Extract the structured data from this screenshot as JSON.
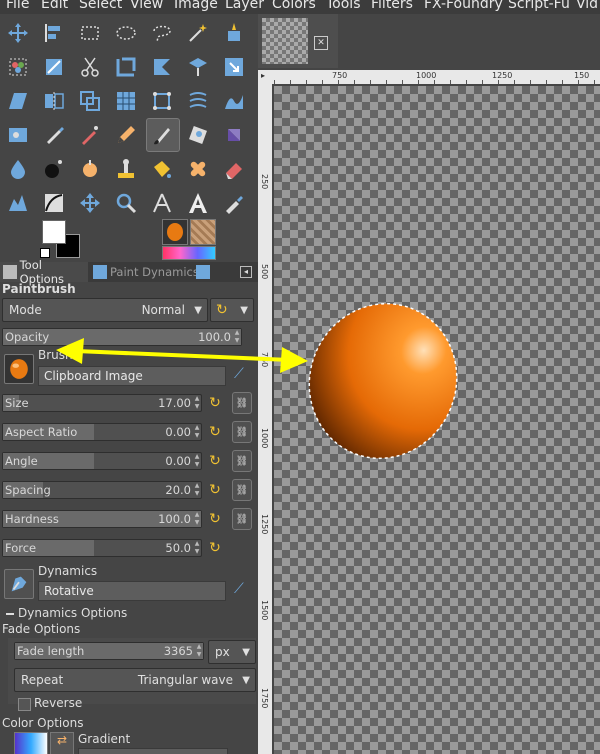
{
  "menubar": {
    "items": [
      "File",
      "Edit",
      "Select",
      "View",
      "Image",
      "Layer",
      "Colors",
      "Tools",
      "Filters",
      "FX-Foundry",
      "Script-Fu",
      "Vid"
    ]
  },
  "toolbox": {
    "tools": [
      [
        "move-tool-icon",
        "align-tool-icon",
        "rect-select-icon",
        "ellipse-select-icon",
        "free-select-icon",
        "fuzzy-select-icon",
        "scissors-select-icon"
      ],
      [
        "color-select-icon",
        "crop-icon",
        "cut-icon",
        "foreground-select-icon",
        "paths-icon",
        "perspective-icon",
        "scale-icon"
      ],
      [
        "shear-icon",
        "flip-icon",
        "layer-group-icon",
        "grid-icon",
        "cage-icon",
        "warp-icon",
        "wave-icon"
      ],
      [
        "heal-icon",
        "ink-icon",
        "airbrush-icon",
        "pencil-icon",
        "paintbrush-icon",
        "eraser-icon",
        "smudge-icon"
      ],
      [
        "drop-icon",
        "ball-icon",
        "clone-icon",
        "stamp-icon",
        "bucket-icon",
        "bandage-icon",
        "eraser-pink-icon"
      ],
      [
        "levels-icon",
        "curves-icon",
        "move-cross-icon",
        "zoom-icon",
        "measure-icon",
        "text-icon",
        "color-picker-icon"
      ]
    ]
  },
  "tabs": {
    "tool_options": "Tool Options",
    "paint_dynamics": "Paint Dynamics"
  },
  "options": {
    "title": "Paintbrush",
    "mode_label": "Mode",
    "mode_value": "Normal",
    "opacity": {
      "label": "Opacity",
      "value": "100.0",
      "fraction": 1.0
    },
    "brush_label": "Brush",
    "brush_value": "Clipboard Image",
    "size": {
      "label": "Size",
      "value": "17.00",
      "fraction": 0.08
    },
    "aspect_ratio": {
      "label": "Aspect Ratio",
      "value": "0.00",
      "fraction": 0.46
    },
    "angle": {
      "label": "Angle",
      "value": "0.00",
      "fraction": 0.46
    },
    "spacing": {
      "label": "Spacing",
      "value": "20.0",
      "fraction": 0.2
    },
    "hardness": {
      "label": "Hardness",
      "value": "100.0",
      "fraction": 1.0
    },
    "force": {
      "label": "Force",
      "value": "50.0",
      "fraction": 0.46
    },
    "dynamics_label": "Dynamics",
    "dynamics_value": "Rotative",
    "dynamics_options": "Dynamics Options",
    "fade_options": "Fade Options",
    "fade_length": {
      "label": "Fade length",
      "value": "3365",
      "fraction": 1.0
    },
    "fade_unit": "px",
    "repeat_label": "Repeat",
    "repeat_value": "Triangular wave",
    "reverse_label": "Reverse",
    "color_options": "Color Options",
    "gradient_label": "Gradient"
  },
  "ruler": {
    "top": [
      "750",
      "1000",
      "1250",
      "150"
    ],
    "left": [
      "250",
      "500",
      "750",
      "1000",
      "1250",
      "1500",
      "1750"
    ]
  },
  "colors": {
    "accent": "#ffff00",
    "orange": "#e87a12"
  }
}
